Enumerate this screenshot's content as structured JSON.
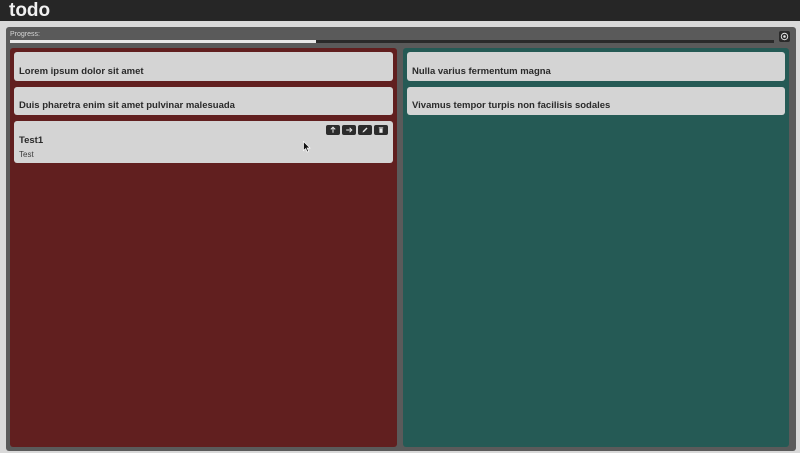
{
  "app": {
    "title": "todo"
  },
  "progress": {
    "label": "Progress:",
    "fraction": 0.4
  },
  "icons": {
    "settings": "gear-icon",
    "move_up": "arrow-up-icon",
    "move_right": "arrow-right-icon",
    "edit": "pencil-icon",
    "delete": "trash-icon"
  },
  "colors": {
    "left_column": "#611f1f",
    "right_column": "#255a55",
    "card": "#d4d4d4",
    "titlebar": "#262626"
  },
  "columns": [
    {
      "cards": [
        {
          "title": "Lorem ipsum dolor sit amet"
        },
        {
          "title": "Duis pharetra enim sit amet pulvinar malesuada"
        },
        {
          "title": "Test1",
          "description": "Test"
        }
      ]
    },
    {
      "cards": [
        {
          "title": "Nulla varius fermentum magna"
        },
        {
          "title": "Vivamus tempor turpis non facilisis sodales"
        }
      ]
    }
  ]
}
